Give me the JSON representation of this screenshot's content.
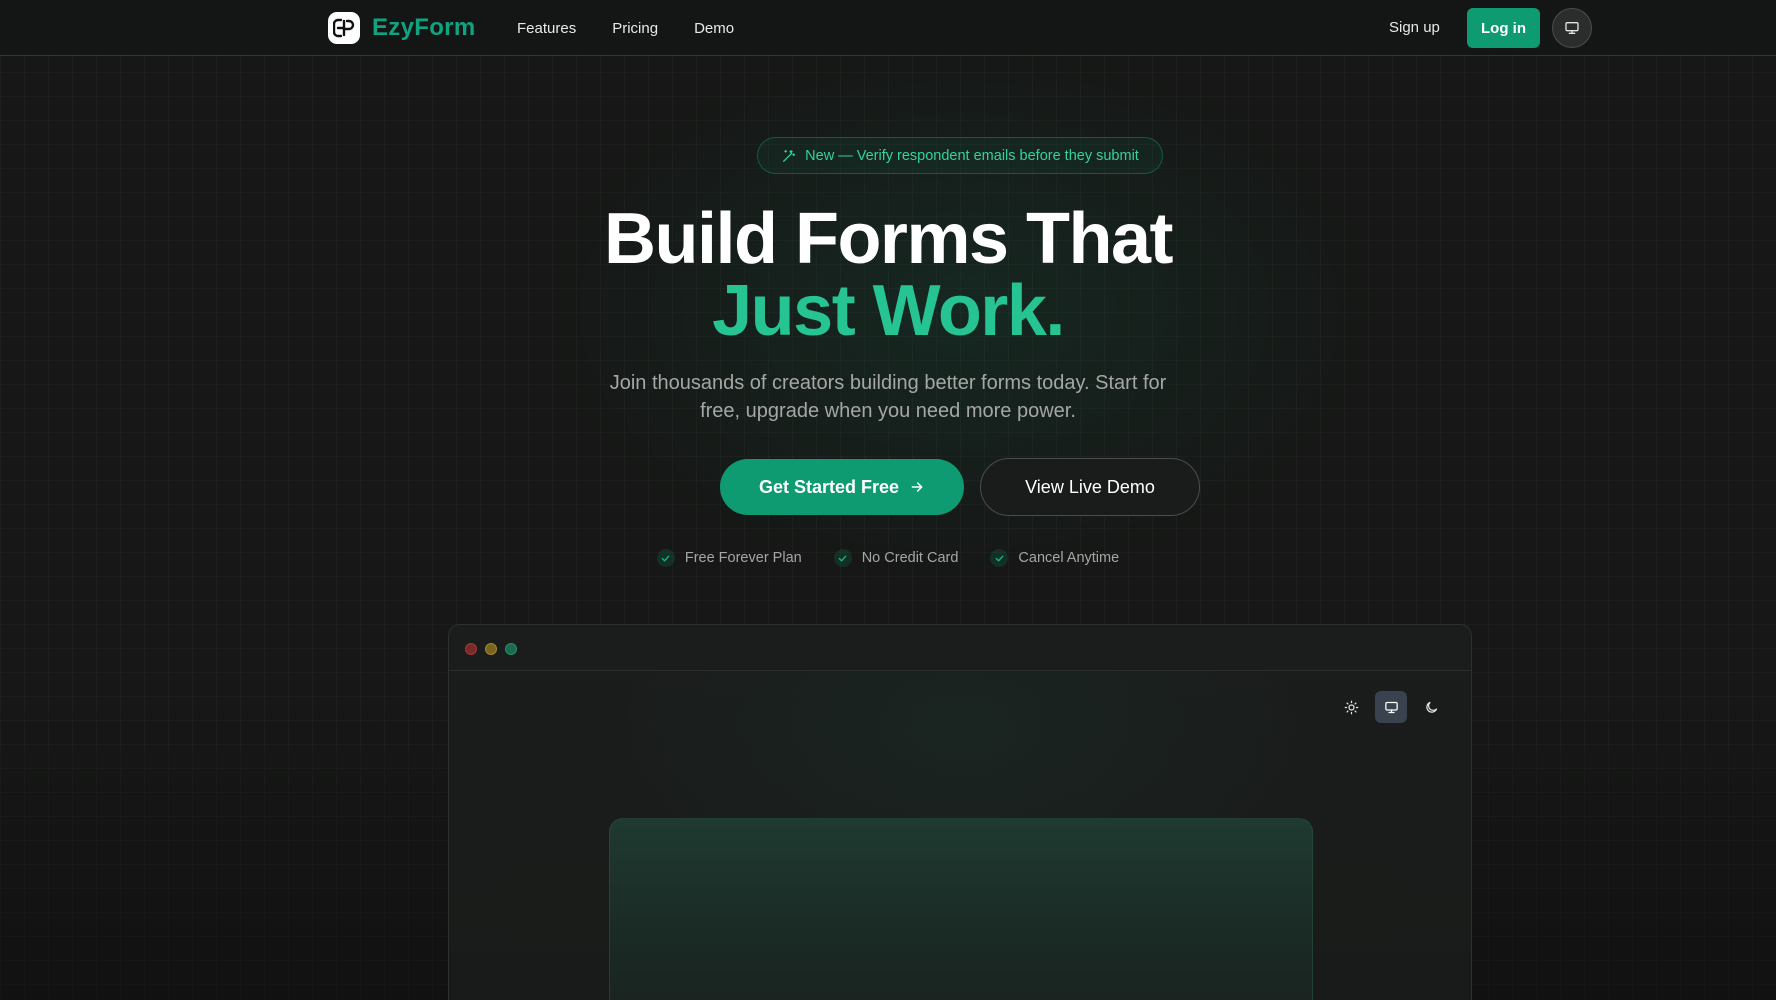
{
  "brand": {
    "name": "EzyForm",
    "logo_icon": "ezyform-logo-icon"
  },
  "nav": {
    "links": [
      {
        "label": "Features"
      },
      {
        "label": "Pricing"
      },
      {
        "label": "Demo"
      }
    ],
    "signup_label": "Sign up",
    "login_label": "Log in",
    "theme_icon": "monitor-icon"
  },
  "hero": {
    "badge_icon": "magic-wand-icon",
    "badge_text": "New — Verify respondent emails before they submit",
    "headline_line1": "Build Forms That",
    "headline_line2": "Just Work.",
    "subtext": "Join thousands of creators building better forms today. Start for free, upgrade when you need more power.",
    "cta_primary": "Get Started Free",
    "cta_primary_icon": "arrow-right-icon",
    "cta_secondary": "View Live Demo",
    "features": [
      {
        "label": "Free Forever Plan",
        "icon": "check-icon"
      },
      {
        "label": "No Credit Card",
        "icon": "check-icon"
      },
      {
        "label": "Cancel Anytime",
        "icon": "check-icon"
      }
    ]
  },
  "preview": {
    "window_controls": [
      "close",
      "minimize",
      "maximize"
    ],
    "theme_options": [
      {
        "name": "light",
        "icon": "sun-icon",
        "active": false
      },
      {
        "name": "system",
        "icon": "monitor-icon",
        "active": true
      },
      {
        "name": "dark",
        "icon": "moon-icon",
        "active": false
      }
    ]
  },
  "colors": {
    "accent": "#0f9b72",
    "accent_text": "#27c493",
    "background": "#161716"
  }
}
